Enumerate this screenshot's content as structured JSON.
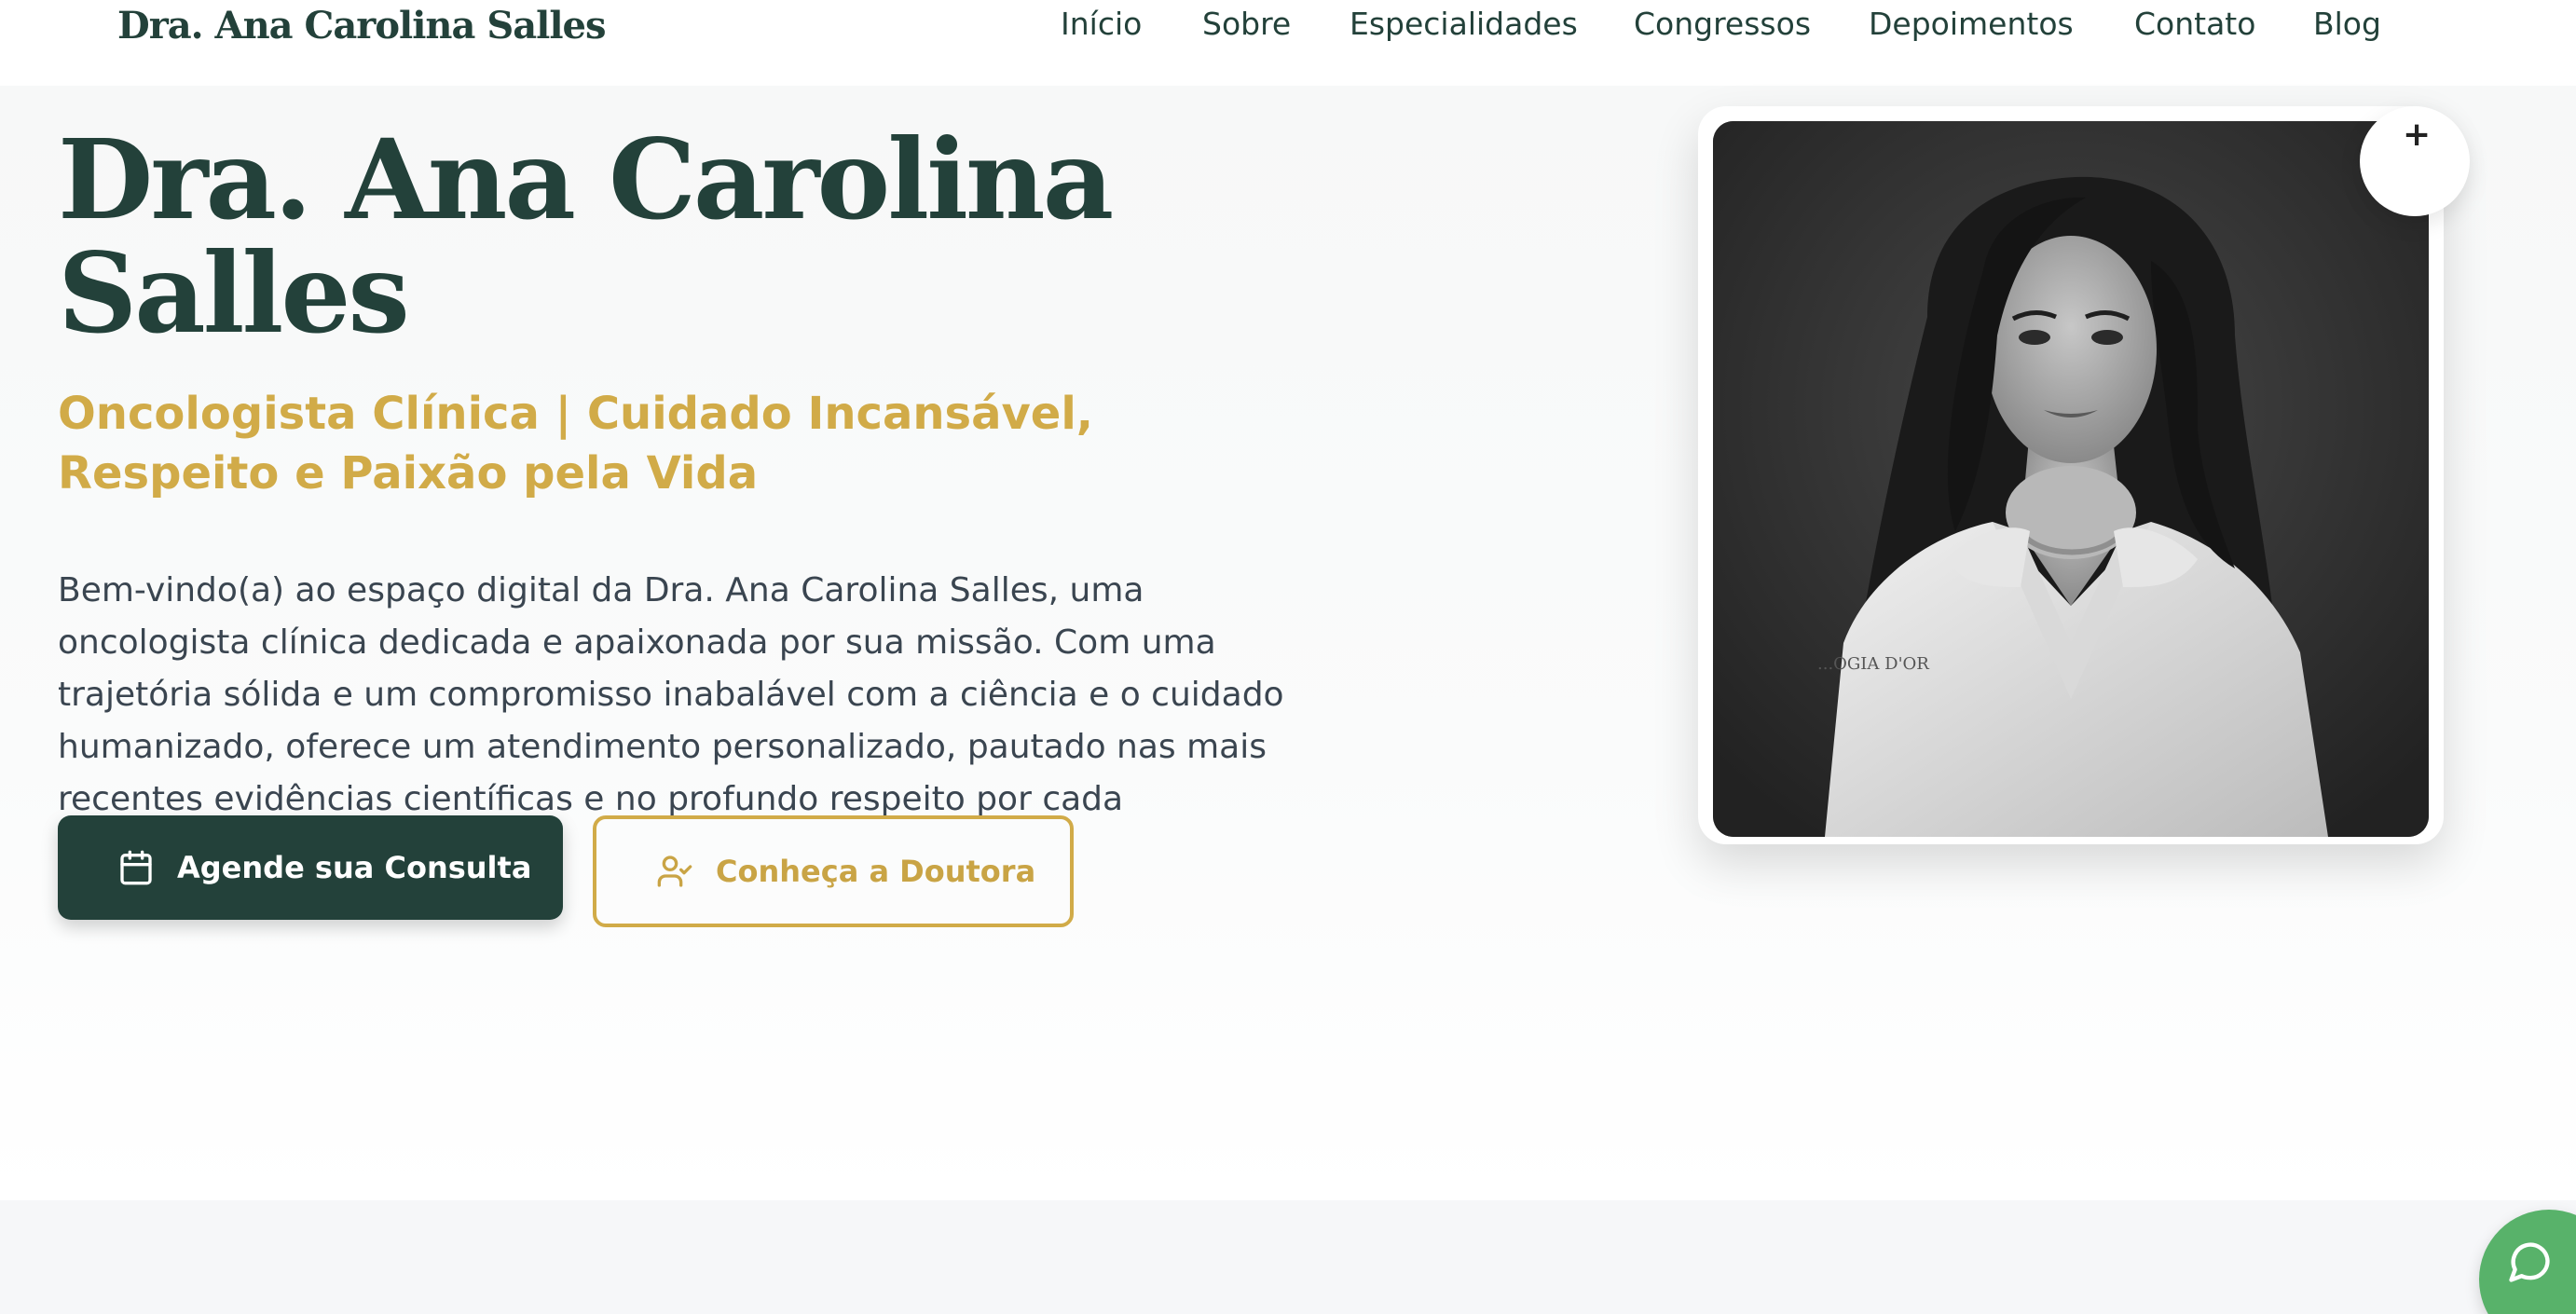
{
  "header": {
    "brand": "Dra. Ana Carolina Salles",
    "nav": [
      {
        "label": "Início"
      },
      {
        "label": "Sobre"
      },
      {
        "label": "Especialidades"
      },
      {
        "label": "Congressos"
      },
      {
        "label": "Depoimentos"
      },
      {
        "label": "Contato"
      },
      {
        "label": "Blog"
      }
    ]
  },
  "hero": {
    "title": "Dra. Ana Carolina Salles",
    "subtitle": "Oncologista Clínica | Cuidado Incansável, Respeito e Paixão pela Vida",
    "description": "Bem-vindo(a) ao espaço digital da Dra. Ana Carolina Salles, uma oncologista clínica dedicada e apaixonada por sua missão. Com uma trajetória sólida e um compromisso inabalável com a ciência e o cuidado humanizado, oferece um atendimento personalizado, pautado nas mais recentes evidências científicas e no profundo respeito por cada paciente.",
    "primary_button": {
      "label": "Agende sua Consulta",
      "icon": "calendar-icon"
    },
    "secondary_button": {
      "label": "Conheça a Doutora",
      "icon": "user-check-icon"
    }
  },
  "photo": {
    "badge_symbol": "+",
    "coat_embroidery": "...OGIA D'OR"
  },
  "chat": {
    "icon": "chat-bubble-icon"
  },
  "colors": {
    "brand_green": "#23413a",
    "gold": "#d1ab48",
    "chat_green": "#58b26a"
  }
}
